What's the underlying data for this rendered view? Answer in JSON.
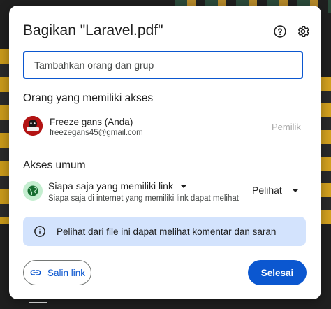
{
  "dialog": {
    "title": "Bagikan \"Laravel.pdf\"",
    "help_icon": "help-circle-icon",
    "settings_icon": "gear-icon"
  },
  "add_people": {
    "placeholder": "Tambahkan orang dan grup"
  },
  "people_with_access": {
    "heading": "Orang yang memiliki akses",
    "people": [
      {
        "name": "Freeze gans (Anda)",
        "email": "freezegans45@gmail.com",
        "role": "Pemilik"
      }
    ]
  },
  "general_access": {
    "heading": "Akses umum",
    "icon": "globe-icon",
    "selected_option": "Siapa saja yang memiliki link",
    "description": "Siapa saja di internet yang memiliki link dapat melihat",
    "role": "Pelihat"
  },
  "info": {
    "icon": "info-icon",
    "text": "Pelihat dari file ini dapat melihat komentar dan saran"
  },
  "actions": {
    "copy_link_label": "Salin link",
    "copy_link_icon": "link-icon",
    "done_label": "Selesai"
  },
  "colors": {
    "accent": "#0b57d0",
    "info_bg": "#d3e3fd",
    "globe_bg": "#c4eed0"
  }
}
